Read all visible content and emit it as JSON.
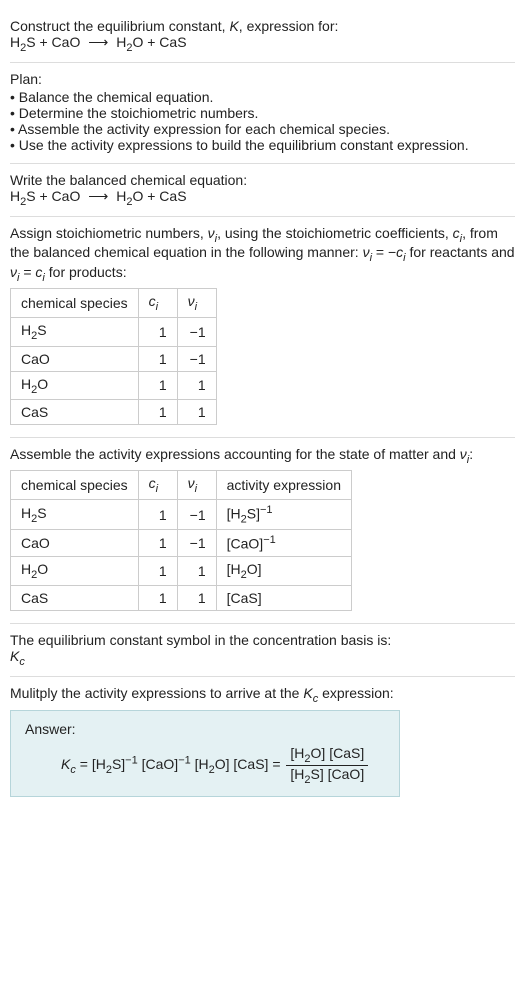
{
  "intro": {
    "line1_pre": "Construct the equilibrium constant, ",
    "line1_k": "K",
    "line1_post": ", expression for:",
    "eq_lhs1": "H",
    "eq_lhs1_sub": "2",
    "eq_lhs1b": "S + CaO",
    "arrow": "⟶",
    "eq_rhs1": "H",
    "eq_rhs1_sub": "2",
    "eq_rhs1b": "O + CaS"
  },
  "plan": {
    "title": "Plan:",
    "items": [
      "Balance the chemical equation.",
      "Determine the stoichiometric numbers.",
      "Assemble the activity expression for each chemical species.",
      "Use the activity expressions to build the equilibrium constant expression."
    ]
  },
  "balanced": {
    "title": "Write the balanced chemical equation:"
  },
  "assign": {
    "text_pre": "Assign stoichiometric numbers, ",
    "nu": "ν",
    "i": "i",
    "text_mid1": ", using the stoichiometric coefficients, ",
    "c": "c",
    "text_mid2": ", from the balanced chemical equation in the following manner: ",
    "eq1_lhs": "ν",
    "eq1_eq": " = −",
    "eq1_rhs": "c",
    "text_react": " for reactants and ",
    "eq2_lhs": "ν",
    "eq2_eq": " = ",
    "eq2_rhs": "c",
    "text_prod": " for products:"
  },
  "table1": {
    "h1": "chemical species",
    "h2_c": "c",
    "h2_i": "i",
    "h3_nu": "ν",
    "h3_i": "i",
    "rows": [
      {
        "s_pre": "H",
        "s_sub": "2",
        "s_post": "S",
        "c": "1",
        "nu": "−1"
      },
      {
        "s_pre": "CaO",
        "s_sub": "",
        "s_post": "",
        "c": "1",
        "nu": "−1"
      },
      {
        "s_pre": "H",
        "s_sub": "2",
        "s_post": "O",
        "c": "1",
        "nu": "1"
      },
      {
        "s_pre": "CaS",
        "s_sub": "",
        "s_post": "",
        "c": "1",
        "nu": "1"
      }
    ]
  },
  "assemble": {
    "text_pre": "Assemble the activity expressions accounting for the state of matter and ",
    "nu": "ν",
    "i": "i",
    "text_post": ":"
  },
  "table2": {
    "h1": "chemical species",
    "h4": "activity expression",
    "rows": [
      {
        "s_pre": "H",
        "s_sub": "2",
        "s_post": "S",
        "c": "1",
        "nu": "−1",
        "a_open": "[H",
        "a_sub": "2",
        "a_mid": "S]",
        "a_sup": "−1"
      },
      {
        "s_pre": "CaO",
        "s_sub": "",
        "s_post": "",
        "c": "1",
        "nu": "−1",
        "a_open": "[CaO]",
        "a_sub": "",
        "a_mid": "",
        "a_sup": "−1"
      },
      {
        "s_pre": "H",
        "s_sub": "2",
        "s_post": "O",
        "c": "1",
        "nu": "1",
        "a_open": "[H",
        "a_sub": "2",
        "a_mid": "O]",
        "a_sup": ""
      },
      {
        "s_pre": "CaS",
        "s_sub": "",
        "s_post": "",
        "c": "1",
        "nu": "1",
        "a_open": "[CaS]",
        "a_sub": "",
        "a_mid": "",
        "a_sup": ""
      }
    ]
  },
  "symbol": {
    "text": "The equilibrium constant symbol in the concentration basis is:",
    "K": "K",
    "c": "c"
  },
  "multiply": {
    "text_pre": "Mulitply the activity expressions to arrive at the ",
    "K": "K",
    "c": "c",
    "text_post": " expression:"
  },
  "answer": {
    "label": "Answer:",
    "K": "K",
    "c": "c",
    "eq": " = ",
    "t1_open": "[H",
    "t1_sub": "2",
    "t1_mid": "S]",
    "t1_sup": "−1",
    "sp": " ",
    "t2_open": "[CaO]",
    "t2_sup": "−1",
    "t3_open": "[H",
    "t3_sub": "2",
    "t3_mid": "O]",
    "t4": "[CaS]",
    "eq2": " = ",
    "frac_top_1": "[H",
    "frac_top_1_sub": "2",
    "frac_top_1_mid": "O] [CaS]",
    "frac_bot_1": "[H",
    "frac_bot_1_sub": "2",
    "frac_bot_1_mid": "S] [CaO]"
  }
}
